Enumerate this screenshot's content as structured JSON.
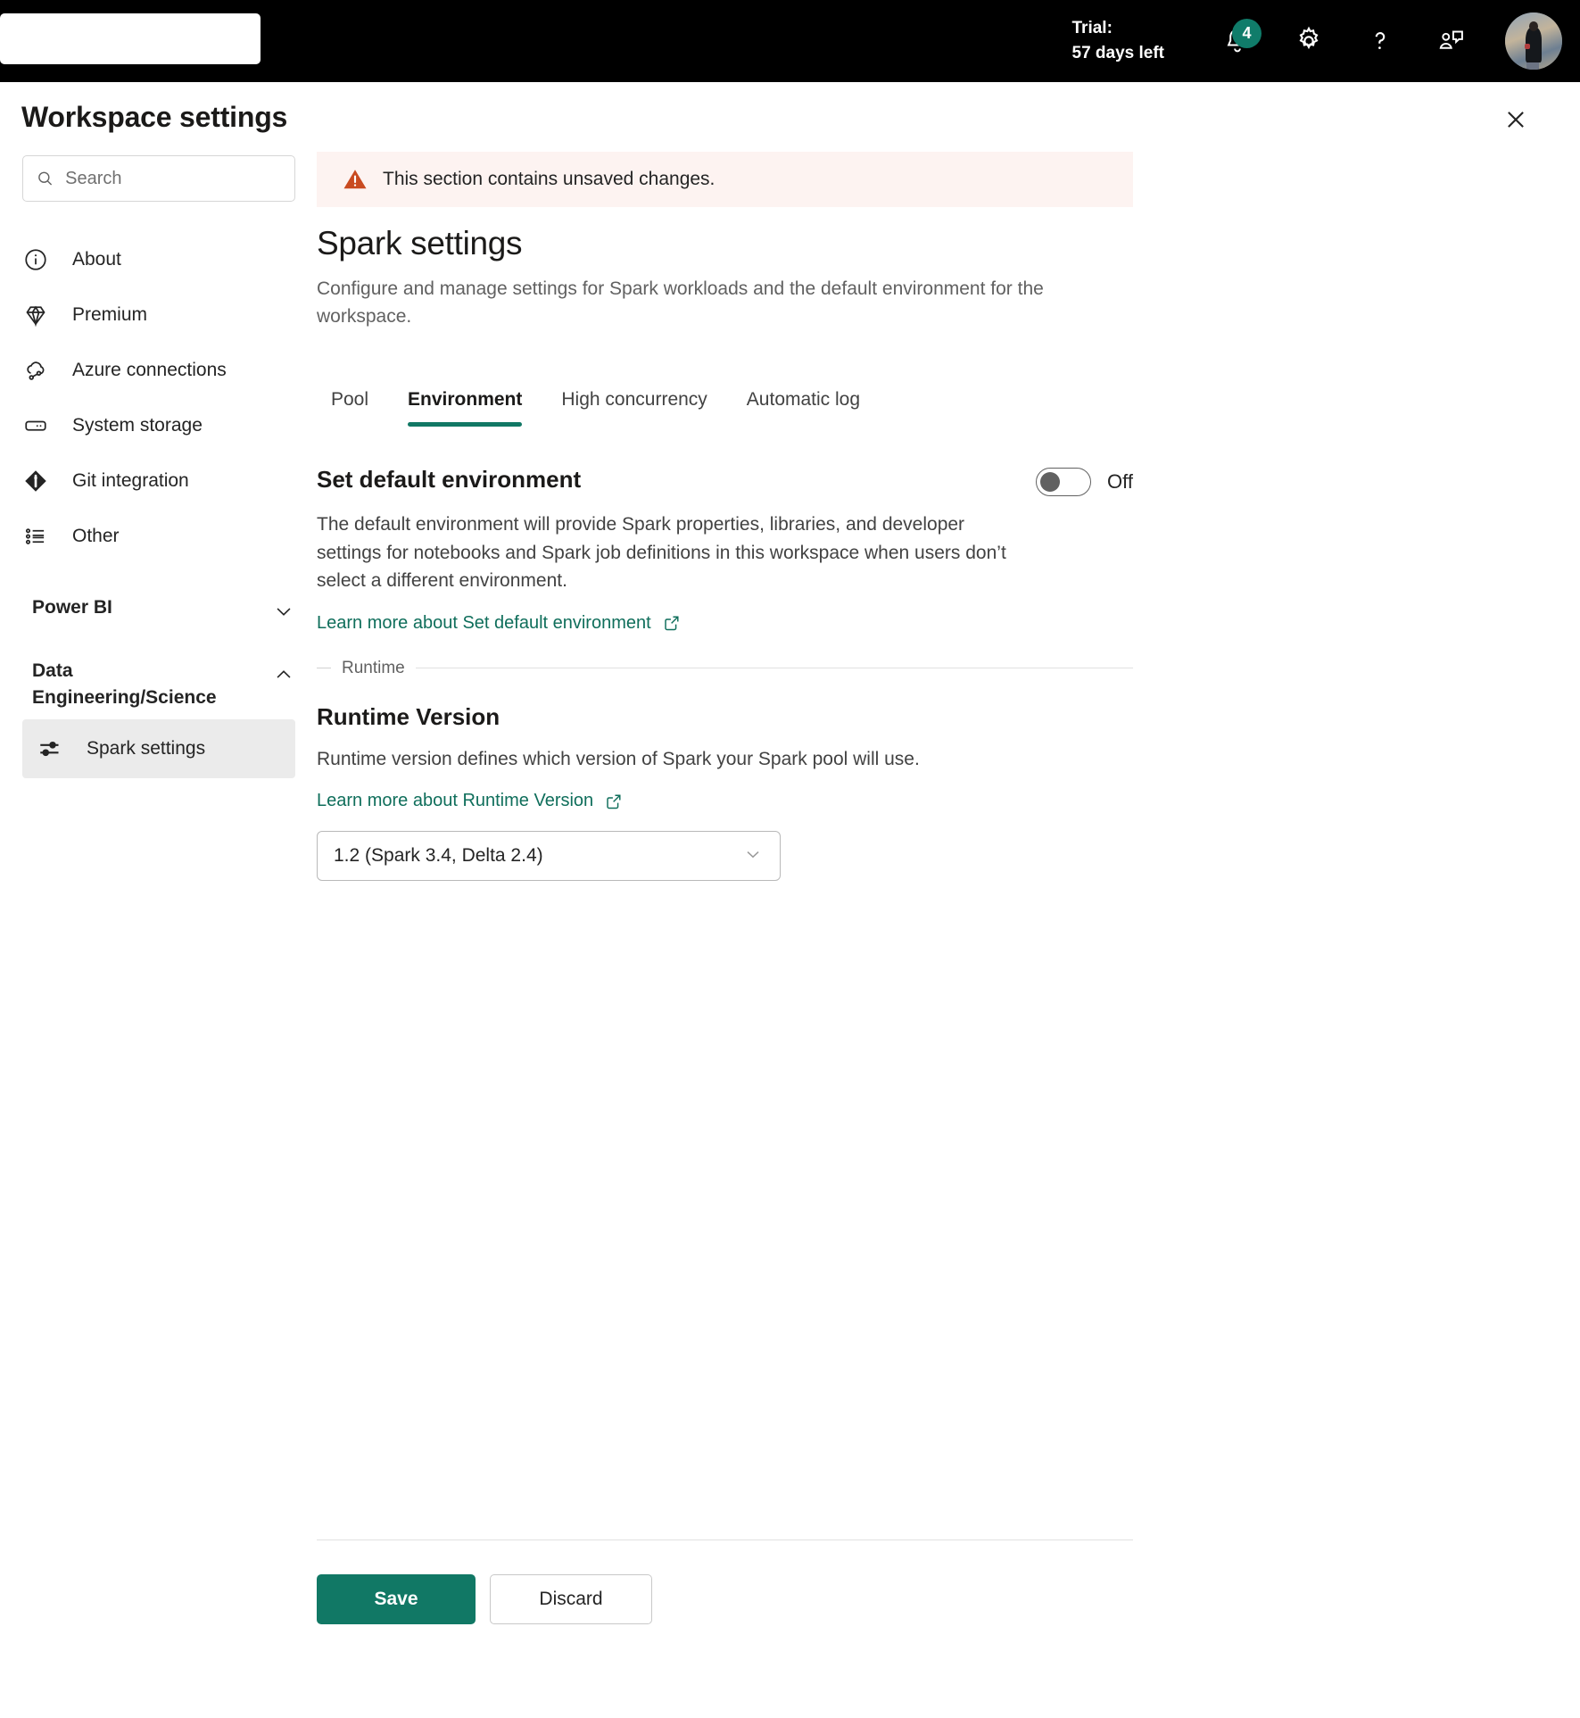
{
  "appbar": {
    "search_placeholder": "",
    "trial_line1": "Trial:",
    "trial_line2": "57 days left",
    "notification_count": "4",
    "icons": {
      "notifications": "bell-icon",
      "settings": "gear-icon",
      "help": "question-mark-icon",
      "feedback": "feedback-icon",
      "avatar": "user-avatar"
    }
  },
  "panel": {
    "title": "Workspace settings",
    "close_label": "Close"
  },
  "search": {
    "placeholder": "Search",
    "value": ""
  },
  "sidebar": {
    "items": [
      {
        "label": "About",
        "icon": "info-icon"
      },
      {
        "label": "Premium",
        "icon": "diamond-icon"
      },
      {
        "label": "Azure connections",
        "icon": "cloud-link-icon"
      },
      {
        "label": "System storage",
        "icon": "storage-icon"
      },
      {
        "label": "Git integration",
        "icon": "git-icon"
      },
      {
        "label": "Other",
        "icon": "list-icon"
      }
    ],
    "groups": [
      {
        "label": "Power BI",
        "expanded": false,
        "chevron": "chevron-down-icon",
        "children": []
      },
      {
        "label": "Data Engineering/Science",
        "expanded": true,
        "chevron": "chevron-up-icon",
        "children": [
          {
            "label": "Spark settings",
            "icon": "sliders-icon",
            "selected": true
          }
        ]
      }
    ]
  },
  "main": {
    "banner": {
      "icon": "warning-icon",
      "text": "This section contains unsaved changes.",
      "bg_color": "#fdf3f1",
      "icon_color": "#c94a20"
    },
    "heading": "Spark settings",
    "subheading": "Configure and manage settings for Spark workloads and the default environment for the workspace.",
    "tabs": [
      {
        "label": "Pool",
        "active": false
      },
      {
        "label": "Environment",
        "active": true
      },
      {
        "label": "High concurrency",
        "active": false
      },
      {
        "label": "Automatic log",
        "active": false
      }
    ],
    "accent_color": "#117865",
    "sections": [
      {
        "title": "Set default environment",
        "toggle_state": "Off",
        "description": "The default environment will provide Spark properties, libraries, and developer settings for notebooks and Spark job definitions in this workspace when users don’t select a different environment.",
        "link_text": "Learn more about Set default environment",
        "link_icon": "external-link-icon"
      }
    ],
    "divider_label": "Runtime",
    "runtime": {
      "title": "Runtime Version",
      "description": "Runtime version defines which version of Spark your Spark pool will use.",
      "link_text": "Learn more about Runtime Version",
      "link_icon": "external-link-icon",
      "dropdown_value": "1.2 (Spark 3.4, Delta 2.4)",
      "dropdown_icon": "chevron-down-icon"
    },
    "footer": {
      "save_label": "Save",
      "discard_label": "Discard"
    }
  }
}
